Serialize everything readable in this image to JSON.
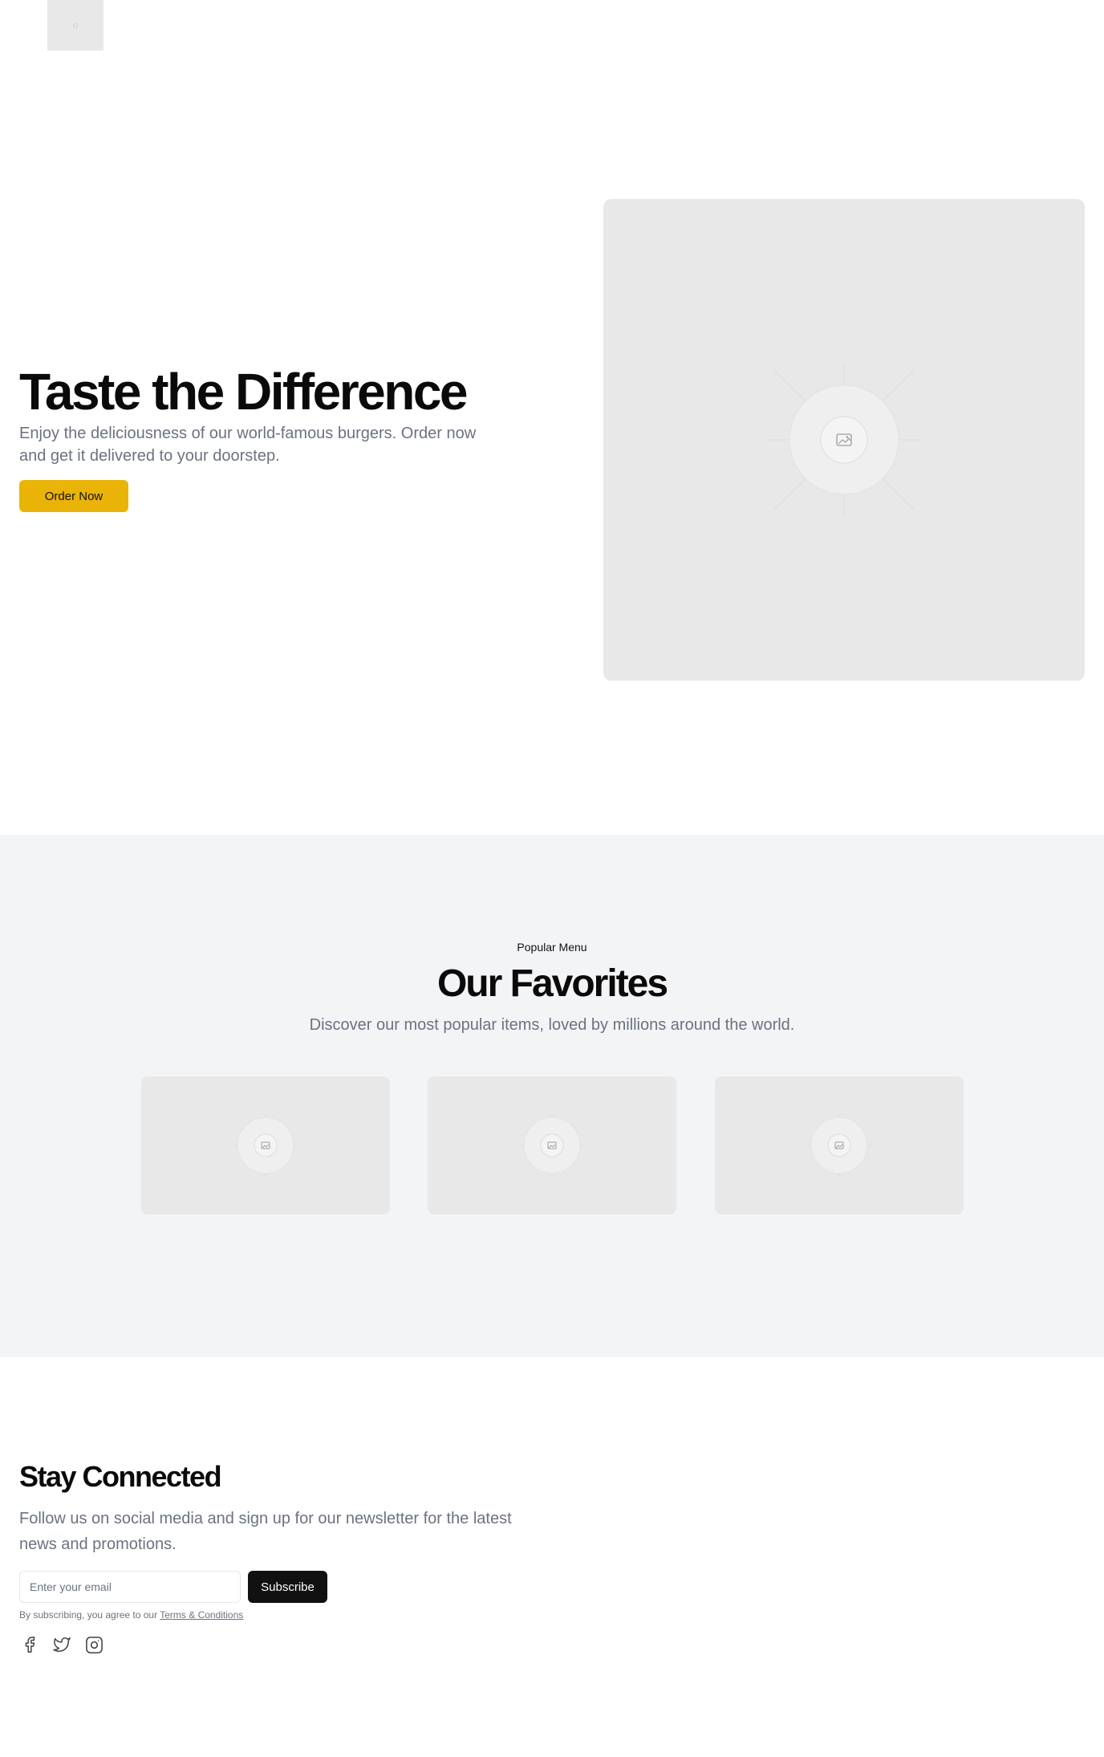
{
  "header": {
    "logo_icon": "logo-placeholder-icon"
  },
  "hero": {
    "title": "Taste the Difference",
    "description": "Enjoy the deliciousness of our world-famous burgers. Order now and get it delivered to your doorstep.",
    "cta_label": "Order Now",
    "image_icon": "image-placeholder-icon"
  },
  "favorites": {
    "eyebrow": "Popular Menu",
    "title": "Our Favorites",
    "description": "Discover our most popular items, loved by millions around the world.",
    "cards": [
      {
        "image_icon": "image-placeholder-icon"
      },
      {
        "image_icon": "image-placeholder-icon"
      },
      {
        "image_icon": "image-placeholder-icon"
      }
    ]
  },
  "newsletter": {
    "title": "Stay Connected",
    "description": "Follow us on social media and sign up for our newsletter for the latest news and promotions.",
    "email_placeholder": "Enter your email",
    "email_value": "",
    "subscribe_label": "Subscribe",
    "terms_prefix": "By subscribing, you agree to our",
    "terms_link": "Terms & Conditions",
    "socials": [
      "facebook-icon",
      "twitter-icon",
      "instagram-icon"
    ]
  },
  "colors": {
    "accent": "#eab308",
    "dark": "#111111",
    "muted_text": "#6b7280",
    "section_bg": "#f3f4f6",
    "placeholder_bg": "#e8e8e8"
  }
}
